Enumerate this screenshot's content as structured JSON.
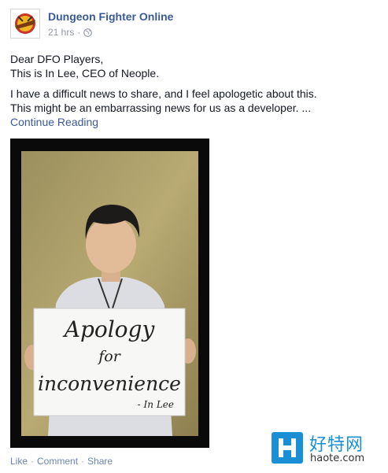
{
  "post": {
    "page_name": "Dungeon Fighter Online",
    "timestamp": "21 hrs",
    "separator": "·",
    "privacy_icon": "globe-icon",
    "lines": [
      "Dear DFO Players,",
      "This is In Lee, CEO of Neople.",
      "I have a difficult news to share, and I feel apologetic about this.",
      "This might be an embarrassing news for us as a developer. ..."
    ],
    "continue_label": "Continue Reading"
  },
  "photo": {
    "sign_lines": [
      "Apology",
      "for",
      "inconvenience",
      "- In Lee"
    ]
  },
  "actions": {
    "like": "Like",
    "comment": "Comment",
    "share": "Share",
    "sep": "·"
  },
  "watermark": {
    "title": "好特网",
    "url": "haote.com"
  },
  "colors": {
    "link": "#3b5998",
    "meta": "#9197a3",
    "watermark": "#1a8fd6"
  }
}
